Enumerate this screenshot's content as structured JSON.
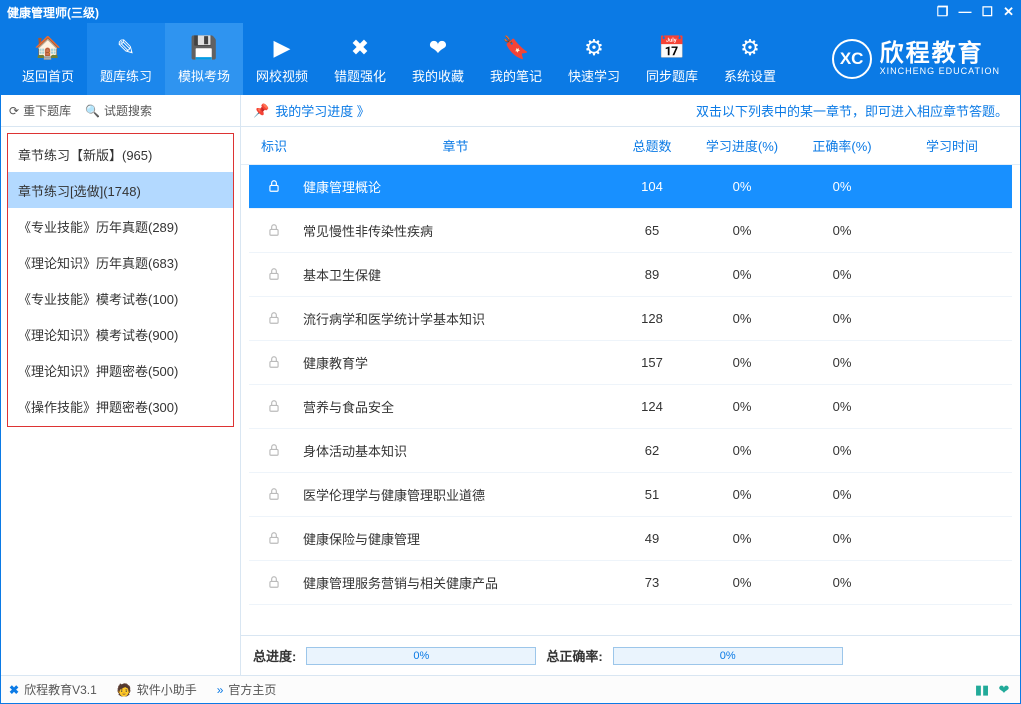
{
  "window_title": "健康管理师(三级)",
  "titlebar_controls": {
    "restore": "❐",
    "min": "—",
    "max": "☐",
    "close": "✕"
  },
  "toolbar": [
    {
      "label": "返回首页",
      "icon": "🏠"
    },
    {
      "label": "题库练习",
      "icon": "✎"
    },
    {
      "label": "模拟考场",
      "icon": "💾"
    },
    {
      "label": "网校视频",
      "icon": "▶"
    },
    {
      "label": "错题强化",
      "icon": "✖"
    },
    {
      "label": "我的收藏",
      "icon": "❤"
    },
    {
      "label": "我的笔记",
      "icon": "🔖"
    },
    {
      "label": "快速学习",
      "icon": "⚙"
    },
    {
      "label": "同步题库",
      "icon": "📅"
    },
    {
      "label": "系统设置",
      "icon": "⚙"
    }
  ],
  "brand": {
    "logo": "XC",
    "main": "欣程教育",
    "sub": "XINCHENG EDUCATION"
  },
  "sidebar_top": {
    "refresh": "重下题库",
    "search": "试题搜索",
    "refresh_icon": "⟳",
    "search_icon": "🔍"
  },
  "categories": [
    "章节练习【新版】(965)",
    "章节练习[选做](1748)",
    "《专业技能》历年真题(289)",
    "《理论知识》历年真题(683)",
    "《专业技能》模考试卷(100)",
    "《理论知识》模考试卷(900)",
    "《理论知识》押题密卷(500)",
    "《操作技能》押题密卷(300)"
  ],
  "selected_category_index": 1,
  "main_top": {
    "progress_link": "我的学习进度 》",
    "pin_icon": "📌",
    "hint": "双击以下列表中的某一章节，即可进入相应章节答题。"
  },
  "columns": {
    "icon": "标识",
    "chapter": "章节",
    "total": "总题数",
    "progress": "学习进度(%)",
    "accuracy": "正确率(%)",
    "time": "学习时间"
  },
  "rows": [
    {
      "chapter": "健康管理概论",
      "total": "104",
      "progress": "0%",
      "accuracy": "0%",
      "time": "",
      "active": true
    },
    {
      "chapter": "常见慢性非传染性疾病",
      "total": "65",
      "progress": "0%",
      "accuracy": "0%",
      "time": ""
    },
    {
      "chapter": "基本卫生保健",
      "total": "89",
      "progress": "0%",
      "accuracy": "0%",
      "time": ""
    },
    {
      "chapter": "流行病学和医学统计学基本知识",
      "total": "128",
      "progress": "0%",
      "accuracy": "0%",
      "time": ""
    },
    {
      "chapter": "健康教育学",
      "total": "157",
      "progress": "0%",
      "accuracy": "0%",
      "time": ""
    },
    {
      "chapter": "营养与食品安全",
      "total": "124",
      "progress": "0%",
      "accuracy": "0%",
      "time": ""
    },
    {
      "chapter": "身体活动基本知识",
      "total": "62",
      "progress": "0%",
      "accuracy": "0%",
      "time": ""
    },
    {
      "chapter": "医学伦理学与健康管理职业道德",
      "total": "51",
      "progress": "0%",
      "accuracy": "0%",
      "time": ""
    },
    {
      "chapter": "健康保险与健康管理",
      "total": "49",
      "progress": "0%",
      "accuracy": "0%",
      "time": ""
    },
    {
      "chapter": "健康管理服务营销与相关健康产品",
      "total": "73",
      "progress": "0%",
      "accuracy": "0%",
      "time": ""
    }
  ],
  "summary": {
    "total_progress_label": "总进度:",
    "total_progress_val": "0%",
    "total_accuracy_label": "总正确率:",
    "total_accuracy_val": "0%"
  },
  "statusbar": {
    "app": "欣程教育V3.1",
    "helper": "软件小助手",
    "official": "官方主页",
    "app_icon": "✖",
    "helper_icon": "🧑",
    "arrow": "»"
  }
}
